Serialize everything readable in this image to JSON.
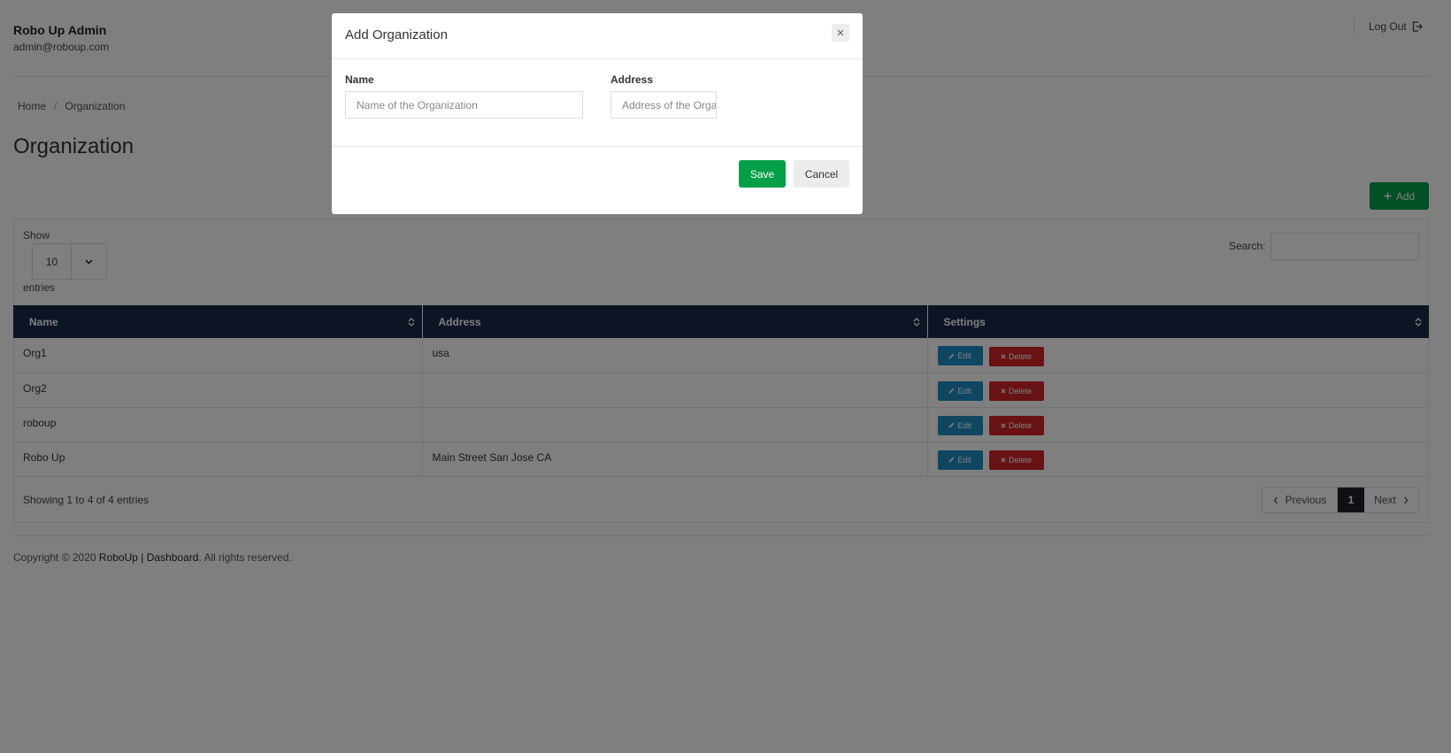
{
  "header": {
    "title": "Robo Up Admin",
    "email": "admin@roboup.com",
    "logout_label": "Log Out"
  },
  "breadcrumb": {
    "home": "Home",
    "separator": "/",
    "current": "Organization"
  },
  "page_title": "Organization",
  "add_button_label": "Add",
  "table_controls": {
    "show_label": "Show",
    "length_value": "10",
    "entries_label": "entries",
    "search_label": "Search:"
  },
  "table": {
    "columns": [
      "Name",
      "Address",
      "Settings"
    ],
    "rows": [
      {
        "name": "Org1",
        "address": "usa"
      },
      {
        "name": "Org2",
        "address": ""
      },
      {
        "name": "roboup",
        "address": ""
      },
      {
        "name": "Robo Up",
        "address": "Main Street San Jose CA"
      }
    ],
    "edit_label": "Edit",
    "delete_label": "Delete"
  },
  "pagination": {
    "info": "Showing 1 to 4 of 4 entries",
    "previous": "Previous",
    "current_page": "1",
    "next": "Next"
  },
  "footer": {
    "prefix": "Copyright © 2020 ",
    "brand": "RoboUp",
    "separator": " | ",
    "dashboard": "Dashboard",
    "suffix": ". All rights reserved."
  },
  "modal": {
    "title": "Add Organization",
    "name_label": "Name",
    "name_placeholder": "Name of the Organization",
    "address_label": "Address",
    "address_placeholder": "Address of the Organization",
    "save_label": "Save",
    "cancel_label": "Cancel"
  },
  "colors": {
    "primary_green": "#04a048",
    "table_header": "#1b2a4a",
    "edit_blue": "#1e8fc7",
    "delete_red": "#d12527"
  }
}
